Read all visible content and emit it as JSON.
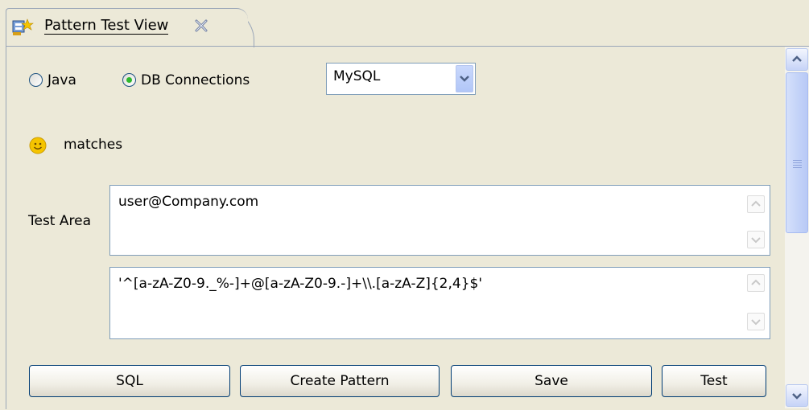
{
  "tab": {
    "title": "Pattern Test View"
  },
  "options": {
    "java_label": "Java",
    "db_label": "DB Connections",
    "selected": "db"
  },
  "db_select": {
    "value": "MySQL"
  },
  "status": {
    "text": "matches"
  },
  "test_area": {
    "label": "Test Area",
    "input_value": "user@Company.com",
    "pattern_value": "'^[a-zA-Z0-9._%-]+@[a-zA-Z0-9.-]+\\\\.[a-zA-Z]{2,4}$'"
  },
  "buttons": {
    "sql": "SQL",
    "create_pattern": "Create Pattern",
    "save": "Save",
    "test": "Test"
  },
  "colors": {
    "accent": "#2eb82e",
    "status_icon": "#f5c400",
    "border": "#7f9db9"
  }
}
